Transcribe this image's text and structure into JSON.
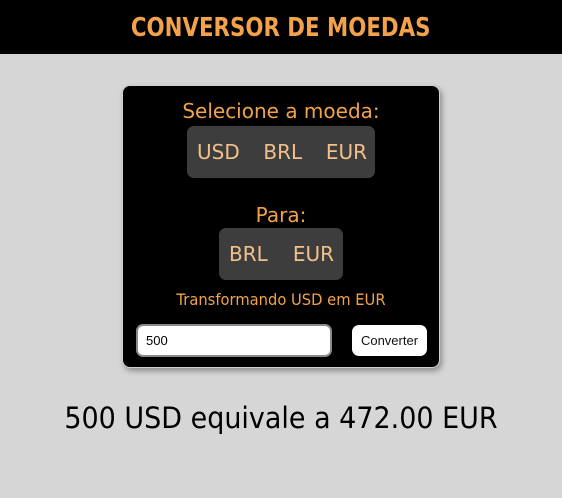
{
  "header": {
    "title": "CONVERSOR DE MOEDAS"
  },
  "converter": {
    "from_label": "Selecione a moeda:",
    "from_options": [
      "USD",
      "BRL",
      "EUR"
    ],
    "to_label": "Para:",
    "to_options": [
      "BRL",
      "EUR"
    ],
    "status_text": "Transformando USD em EUR",
    "amount_value": "500",
    "convert_label": "Converter"
  },
  "result": {
    "text": "500 USD equivale a 472.00 EUR"
  },
  "colors": {
    "header_bg": "#000000",
    "accent": "#f2a24a",
    "option_text": "#f2c08a",
    "option_group_bg": "#3d3d3d",
    "page_bg": "#d6d6d6"
  }
}
